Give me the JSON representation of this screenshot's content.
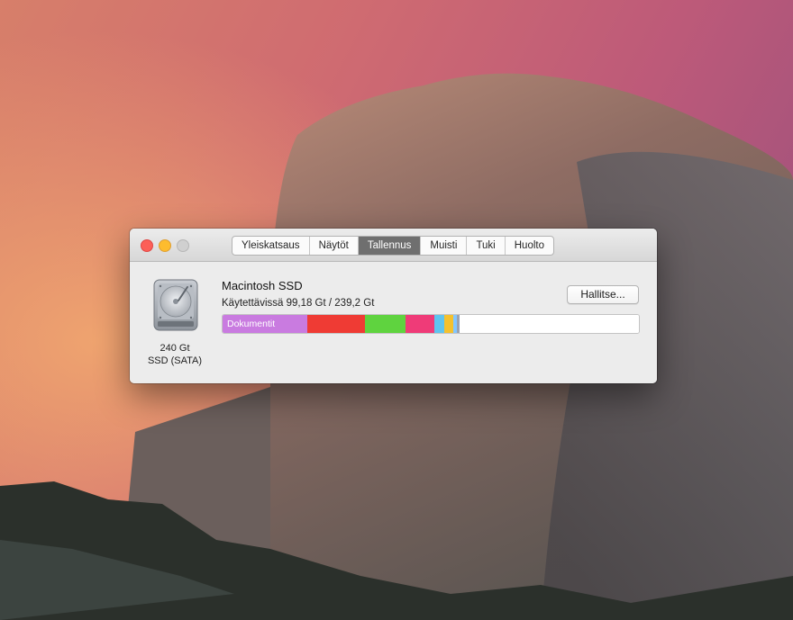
{
  "window": {
    "tabs": [
      {
        "label": "Yleiskatsaus",
        "active": false
      },
      {
        "label": "Näytöt",
        "active": false
      },
      {
        "label": "Tallennus",
        "active": true
      },
      {
        "label": "Muisti",
        "active": false
      },
      {
        "label": "Tuki",
        "active": false
      },
      {
        "label": "Huolto",
        "active": false
      }
    ]
  },
  "disk": {
    "name": "Macintosh SSD",
    "available": "Käytettävissä 99,18 Gt / 239,2 Gt",
    "capacity_line1": "240 Gt",
    "capacity_line2": "SSD (SATA)",
    "icon": "hard-drive-icon"
  },
  "manage_button_label": "Hallitse...",
  "storage_bar": {
    "segments": [
      {
        "name": "documents",
        "label": "Dokumentit",
        "fraction": 0.204,
        "color": "#c97be0"
      },
      {
        "name": "red-category",
        "label": "",
        "fraction": 0.137,
        "color": "#ef3b34"
      },
      {
        "name": "green-category",
        "label": "",
        "fraction": 0.098,
        "color": "#5fd33f"
      },
      {
        "name": "pink-category",
        "label": "",
        "fraction": 0.069,
        "color": "#ef3b78"
      },
      {
        "name": "blue-category",
        "label": "",
        "fraction": 0.024,
        "color": "#5fc4ef"
      },
      {
        "name": "yellow-category",
        "label": "",
        "fraction": 0.022,
        "color": "#f4c12e"
      },
      {
        "name": "lightblue-category",
        "label": "",
        "fraction": 0.009,
        "color": "#82c6ff"
      },
      {
        "name": "gray-category",
        "label": "",
        "fraction": 0.007,
        "color": "#9aa2b0"
      },
      {
        "name": "available-space",
        "label": "",
        "fraction": 0.43,
        "color": "#ffffff"
      }
    ]
  },
  "colors": {
    "close": "#fc5f57",
    "minimize": "#fdbc2e",
    "zoom": "#d0d0d0",
    "active_tab": "#6f6f6f"
  }
}
